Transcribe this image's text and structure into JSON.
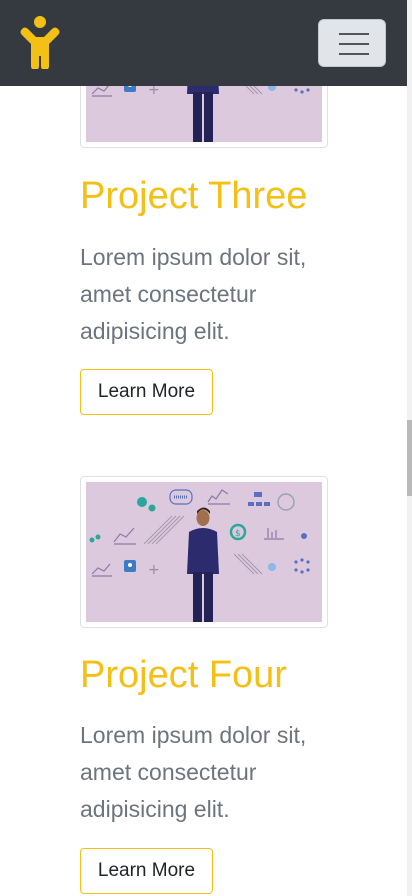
{
  "navbar": {
    "brand_icon": "person-figure-icon",
    "toggler_icon": "hamburger-icon",
    "colors": {
      "background": "#343a40",
      "brand": "#f5c015"
    }
  },
  "projects": [
    {
      "title": "Project Three",
      "text": "Lorem ipsum dolor sit, amet consectetur adipisicing elit.",
      "button_label": "Learn More",
      "image_icon": "business-strategy-illustration-icon"
    },
    {
      "title": "Project Four",
      "text": "Lorem ipsum dolor sit, amet consectetur adipisicing elit.",
      "button_label": "Learn More",
      "image_icon": "business-strategy-illustration-icon"
    }
  ],
  "theme": {
    "accent": "#f5c015",
    "body_text": "#6c757d",
    "image_background": "#dcc9dd"
  }
}
